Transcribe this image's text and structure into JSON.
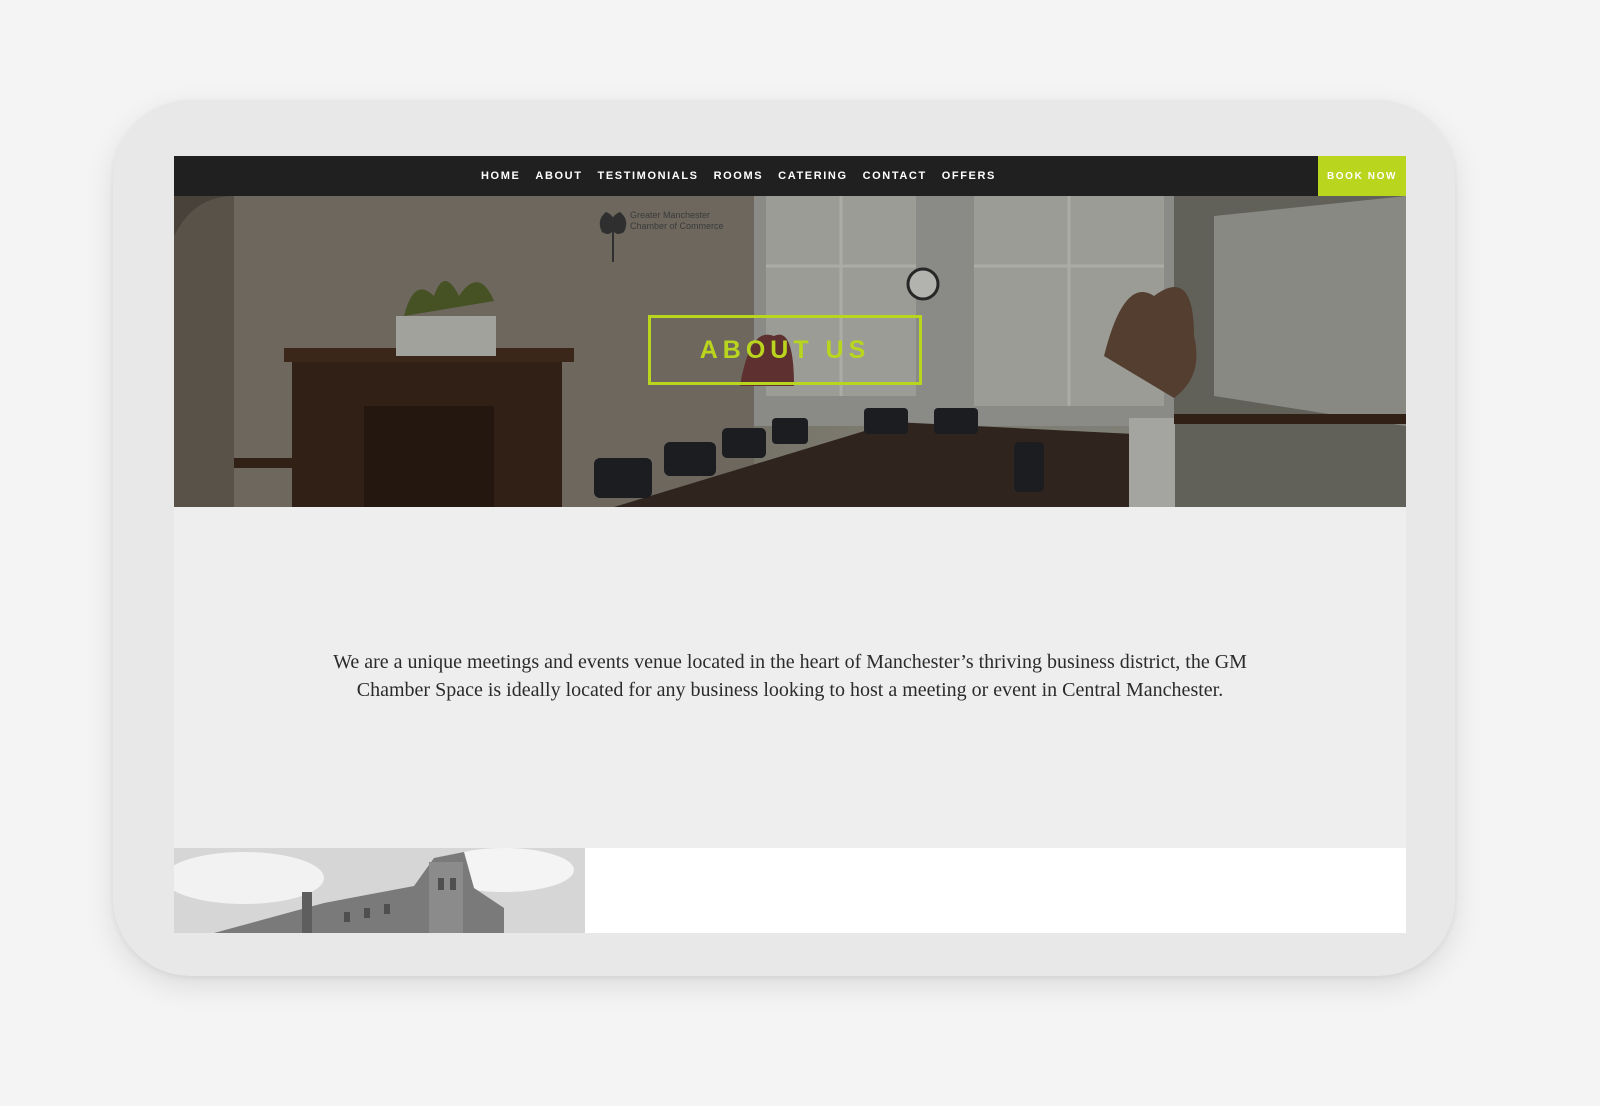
{
  "nav": {
    "items": [
      "HOME",
      "ABOUT",
      "TESTIMONIALS",
      "ROOMS",
      "CATERING",
      "CONTACT",
      "OFFERS"
    ],
    "cta": "BOOK NOW"
  },
  "hero": {
    "title": "ABOUT US",
    "photo_description": "Meeting room with boardroom table, chairs, fireplace, plants and windows",
    "logo_text": [
      "Greater Manchester",
      "Chamber of Commerce"
    ]
  },
  "intro": {
    "text": "We are a unique meetings and events venue located in the heart of Manchester’s thriving business district, the GM Chamber Space is ideally located for any business looking to host a meeting or event in Central Manchester."
  },
  "colors": {
    "accent": "#bad51d",
    "navbar": "#202020",
    "content_bg": "#eeeeee"
  }
}
